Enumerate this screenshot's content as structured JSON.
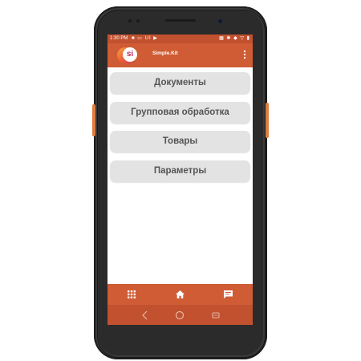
{
  "status_bar": {
    "time": "1:30 PM",
    "left_icons": "■ ▭ UI ▶",
    "right_icons": "▦ ✱ ◆ ▽ ▮"
  },
  "app_bar": {
    "logo_text": "si",
    "title": "Simple.Kit",
    "overflow_icon": "more-vert-icon"
  },
  "menu": {
    "items": [
      {
        "label": "Документы"
      },
      {
        "label": "Групповая обработка"
      },
      {
        "label": "Товары"
      },
      {
        "label": "Параметры"
      }
    ]
  },
  "bottom_nav": {
    "items": [
      "apps-grid-icon",
      "home-icon",
      "message-icon"
    ]
  },
  "system_nav": {
    "items": [
      "back-icon",
      "home-circle-icon",
      "recents-icon"
    ]
  },
  "colors": {
    "primary": "#cf5c34",
    "status_bar": "#c1512f",
    "button_bg": "#e3e3e3",
    "button_text": "#555555",
    "side_buttons": "#e07d3f"
  }
}
